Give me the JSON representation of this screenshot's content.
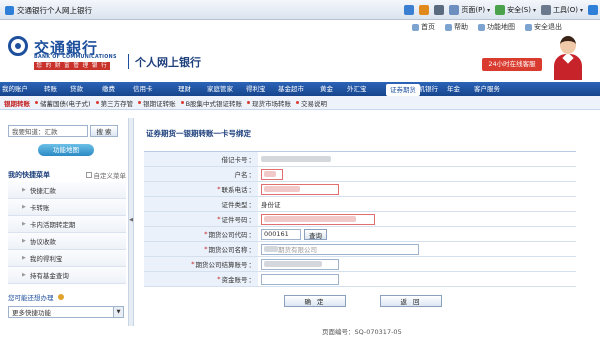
{
  "browser": {
    "tab_title": "交通银行个人网上银行",
    "tools": [
      {
        "label": "",
        "icon": "home-icon"
      },
      {
        "label": "",
        "icon": "feeds-icon"
      },
      {
        "label": "",
        "icon": "print-icon"
      },
      {
        "label": "页面(P)",
        "icon": "page-icon"
      },
      {
        "label": "安全(S)",
        "icon": "safety-icon"
      },
      {
        "label": "工具(O)",
        "icon": "tools-icon"
      },
      {
        "label": "",
        "icon": "help-icon"
      }
    ]
  },
  "header": {
    "bank_name": "交通銀行",
    "bank_name_en": "BANK OF COMMUNICATIONS",
    "slogan": "您 的 财 富 管 理 银 行",
    "product_name": "个人网上银行",
    "top_links": [
      "首页",
      "帮助",
      "功能地图",
      "安全退出"
    ],
    "hotline": "24小时在线客服"
  },
  "main_nav": {
    "items": [
      "我的账户",
      "转账",
      "贷款",
      "缴费",
      "信用卡",
      "理财",
      "家庭管家",
      "得利宝",
      "基金超市",
      "黄金",
      "外汇宝",
      "证券期货",
      "手机银行",
      "年金",
      "客户服务"
    ],
    "active": "证券期货"
  },
  "sub_nav": {
    "items": [
      "银期转账",
      "储蓄国债(电子式)",
      "第三方存管",
      "银期证转账",
      "B股集中式银证转账",
      "现货市场转账",
      "交易说明"
    ],
    "active": "银期转账"
  },
  "sidebar": {
    "search_placeholder": "我要知道：汇款",
    "search_button": "搜 索",
    "function_map": "功能地图",
    "menu_title": "我的快捷菜单",
    "menu_custom": "自定义菜单",
    "menu_items": [
      "快捷汇款",
      "卡转账",
      "卡内活期转定期",
      "协议收款",
      "我的得利宝",
      "持有基金查询"
    ],
    "maybe_label": "您可能还想办理",
    "more_select": "更多快捷功能"
  },
  "form": {
    "title": "证券期货一银期转账一卡号绑定",
    "rows": [
      {
        "label": "借记卡号",
        "required": false,
        "type": "masked"
      },
      {
        "label": "户名",
        "required": false,
        "type": "input-err"
      },
      {
        "label": "联系电话",
        "required": true,
        "type": "input-err"
      },
      {
        "label": "证件类型",
        "required": false,
        "type": "text",
        "value": "身份证"
      },
      {
        "label": "证件号码",
        "required": true,
        "type": "input-err-wide"
      },
      {
        "label": "期货公司代码",
        "required": true,
        "type": "code",
        "value": "000161",
        "button": "查询"
      },
      {
        "label": "期货公司名称",
        "required": true,
        "type": "company",
        "value": "期货有限公司"
      },
      {
        "label": "期货公司结算账号",
        "required": true,
        "type": "masked-input"
      },
      {
        "label": "资金账号",
        "required": true,
        "type": "input"
      }
    ],
    "confirm": "确 定",
    "back": "返 回",
    "page_code": "页面编号：SQ-070317-05"
  },
  "colors": {
    "brand_blue": "#1d4f9c",
    "accent_red": "#c9322a",
    "nav_blue": "#17458c"
  }
}
